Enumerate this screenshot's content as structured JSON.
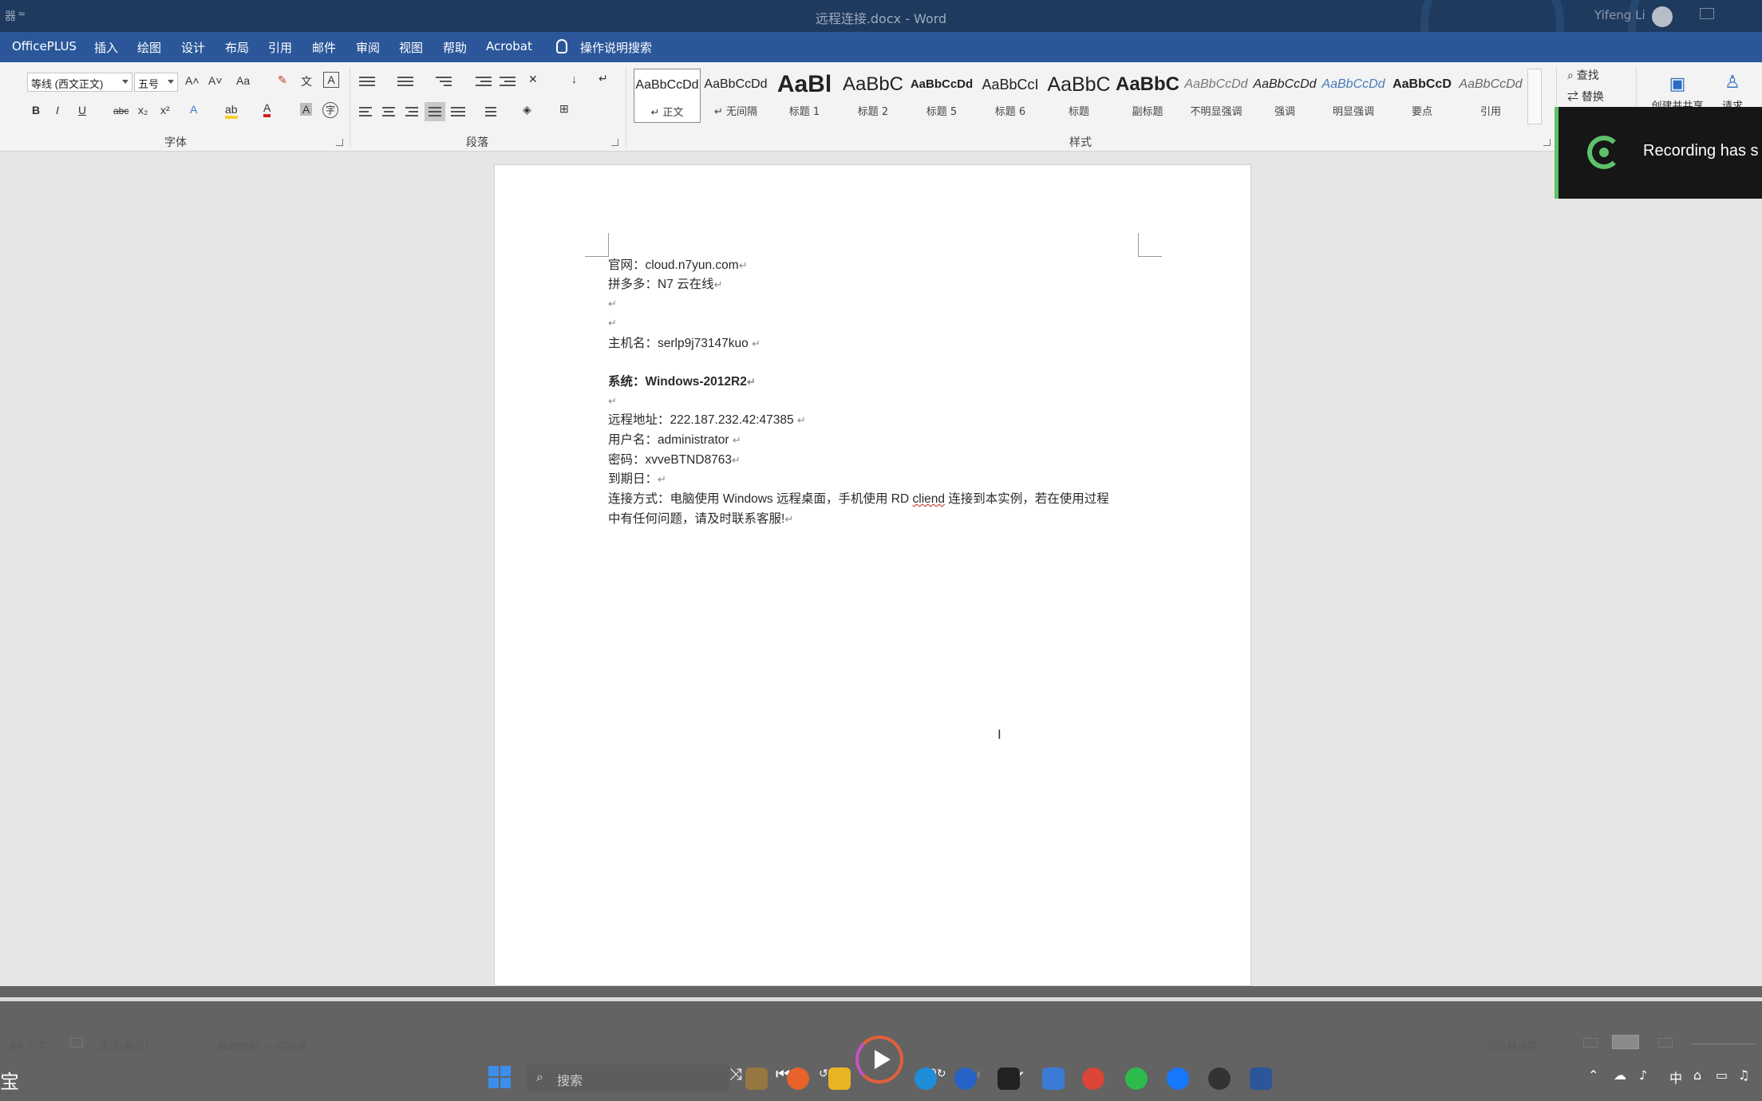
{
  "titlebar": {
    "quick_access": "器",
    "quick_access_2": "≈",
    "title": "远程连接.docx  -  Word",
    "user": "Yifeng Li"
  },
  "menu": {
    "tabs": [
      "OfficePLUS",
      "插入",
      "绘图",
      "设计",
      "布局",
      "引用",
      "邮件",
      "审阅",
      "视图",
      "帮助",
      "Acrobat"
    ],
    "tell_me": "操作说明搜索"
  },
  "ribbon": {
    "font": {
      "font_name": "等线 (西文正文)",
      "font_size": "五号",
      "grow": "A˄",
      "shrink": "A˅",
      "case": "Aa",
      "bold": "B",
      "italic": "I",
      "underline": "U",
      "strike": "abc",
      "subscript": "x₂",
      "superscript": "x²",
      "label": "字体"
    },
    "paragraph_label": "段落",
    "styles_label": "样式",
    "styles": [
      {
        "preview": "AaBbCcDd",
        "name": "↵ 正文"
      },
      {
        "preview": "AaBbCcDd",
        "name": "↵ 无间隔"
      },
      {
        "preview": "AaBl",
        "name": "标题 1"
      },
      {
        "preview": "AaBbC",
        "name": "标题 2"
      },
      {
        "preview": "AaBbCcDd",
        "name": "标题 5"
      },
      {
        "preview": "AaBbCcI",
        "name": "标题 6"
      },
      {
        "preview": "AaBbC",
        "name": "标题"
      },
      {
        "preview": "AaBbC",
        "name": "副标题"
      },
      {
        "preview": "AaBbCcDd",
        "name": "不明显强调"
      },
      {
        "preview": "AaBbCcDd",
        "name": "强调"
      },
      {
        "preview": "AaBbCcDd",
        "name": "明显强调"
      },
      {
        "preview": "AaBbCcD",
        "name": "要点"
      },
      {
        "preview": "AaBbCcDd",
        "name": "引用"
      }
    ],
    "editing": {
      "find": "查找",
      "replace": "替换",
      "create_share": "创建并共享",
      "request": "请求"
    }
  },
  "document": {
    "lines": [
      {
        "text": "官网：cloud.n7yun.com",
        "bold": false
      },
      {
        "text": "拼多多：N7 云在线",
        "bold": false
      },
      {
        "text": "",
        "bold": false
      },
      {
        "text": "",
        "bold": false
      },
      {
        "text": "主机名：serlp9j73147kuo ",
        "bold": false
      },
      {
        "text": "系统：Windows-2012R2",
        "bold": true
      },
      {
        "text": "",
        "bold": false
      },
      {
        "text": "远程地址：222.187.232.42:47385 ",
        "bold": false
      },
      {
        "text": "用户名：administrator ",
        "bold": false
      },
      {
        "text": "密码：xvveBTND8763",
        "bold": false
      },
      {
        "text": "到期日：",
        "bold": false
      },
      {
        "text_before": "连接方式：电脑使用 Windows 远程桌面，手机使用 RD ",
        "misspelled": "cliend",
        "text_after": " 连接到本实例，若在使用过程",
        "bold": false
      },
      {
        "text": "中有任何问题，请及时联系客服!",
        "bold": false
      }
    ],
    "para_mark": "↵"
  },
  "toast": {
    "message": "Recording has s"
  },
  "statusbar": {
    "word_count": "89 个字",
    "language": "英语(美国)",
    "accessibility": "辅助功能: 一切就绪",
    "display_settings": "显示器设置"
  },
  "taskbar": {
    "left_glyph": "宝",
    "search_placeholder": "搜索",
    "ime": "中"
  },
  "player": {
    "rewind_label": "10",
    "forward_label": "30"
  },
  "colors": {
    "title_bg": "#1f3a5f",
    "menu_bg": "#2b579a",
    "toast_accent": "#5ec16b"
  }
}
